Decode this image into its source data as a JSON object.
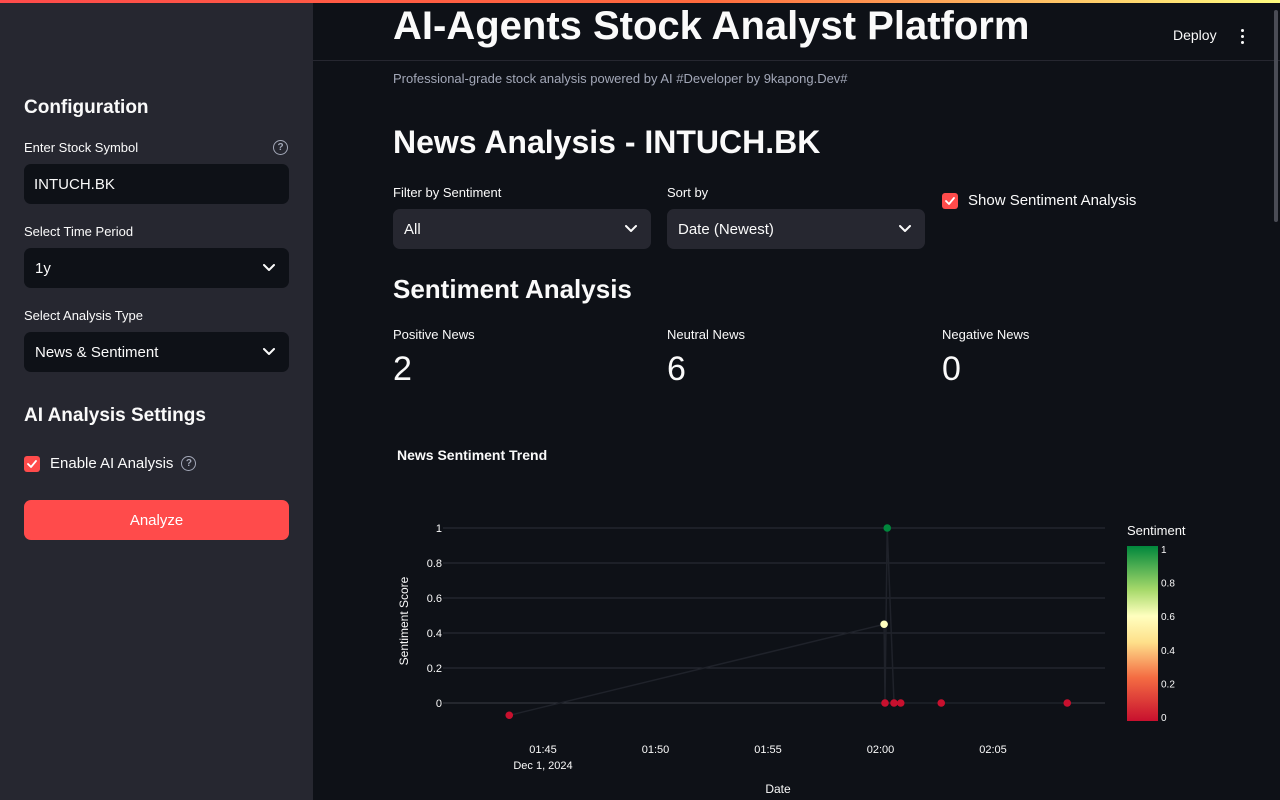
{
  "sidebar": {
    "config_heading": "Configuration",
    "symbol_label": "Enter Stock Symbol",
    "symbol_value": "INTUCH.BK",
    "help_glyph": "?",
    "period_label": "Select Time Period",
    "period_value": "1y",
    "analysis_type_label": "Select Analysis Type",
    "analysis_type_value": "News & Sentiment",
    "ai_heading": "AI Analysis Settings",
    "enable_ai_label": "Enable AI Analysis",
    "enable_ai_checked": true,
    "analyze_button": "Analyze"
  },
  "header": {
    "title": "AI-Agents Stock Analyst Platform",
    "deploy": "Deploy",
    "subtitle": "Professional-grade stock analysis powered by AI #Developer by 9kapong.Dev#"
  },
  "main": {
    "news_title": "News Analysis - INTUCH.BK",
    "filter_label": "Filter by Sentiment",
    "filter_value": "All",
    "sort_label": "Sort by",
    "sort_value": "Date (Newest)",
    "show_sentiment_label": "Show Sentiment Analysis",
    "show_sentiment_checked": true,
    "sentiment_heading": "Sentiment Analysis",
    "metrics": [
      {
        "label": "Positive News",
        "value": "2"
      },
      {
        "label": "Neutral News",
        "value": "6"
      },
      {
        "label": "Negative News",
        "value": "0"
      }
    ]
  },
  "colors": {
    "accent": "#ff4b4b",
    "background": "#0e1117",
    "sidebar": "#262730"
  },
  "chart_data": {
    "type": "scatter",
    "title": "News Sentiment Trend",
    "xlabel": "Date",
    "ylabel": "Sentiment Score",
    "colorbar_title": "Sentiment",
    "x_ticks": [
      "01:45",
      "01:50",
      "01:55",
      "02:00",
      "02:05"
    ],
    "x_tick_minutes": [
      105,
      110,
      115,
      120,
      125
    ],
    "x_date_label": "Dec 1, 2024",
    "y_ticks": [
      0,
      0.2,
      0.4,
      0.6,
      0.8,
      1
    ],
    "colorbar_ticks": [
      0,
      0.2,
      0.4,
      0.6,
      0.8,
      1
    ],
    "xlim_minutes": [
      104.0,
      130.0
    ],
    "ylim": [
      -0.07,
      1.0
    ],
    "points": [
      {
        "x_minutes": 103.5,
        "y": -0.07,
        "sentiment": 0
      },
      {
        "x_minutes": 120.16,
        "y": 0.45,
        "sentiment": 0.45
      },
      {
        "x_minutes": 120.3,
        "y": 1.0,
        "sentiment": 1
      },
      {
        "x_minutes": 120.2,
        "y": 0,
        "sentiment": 0
      },
      {
        "x_minutes": 120.6,
        "y": 0,
        "sentiment": 0
      },
      {
        "x_minutes": 120.9,
        "y": 0,
        "sentiment": 0
      },
      {
        "x_minutes": 122.7,
        "y": 0,
        "sentiment": 0
      },
      {
        "x_minutes": 128.3,
        "y": 0,
        "sentiment": 0
      }
    ],
    "grid": true,
    "legend": "colorbar-right"
  }
}
